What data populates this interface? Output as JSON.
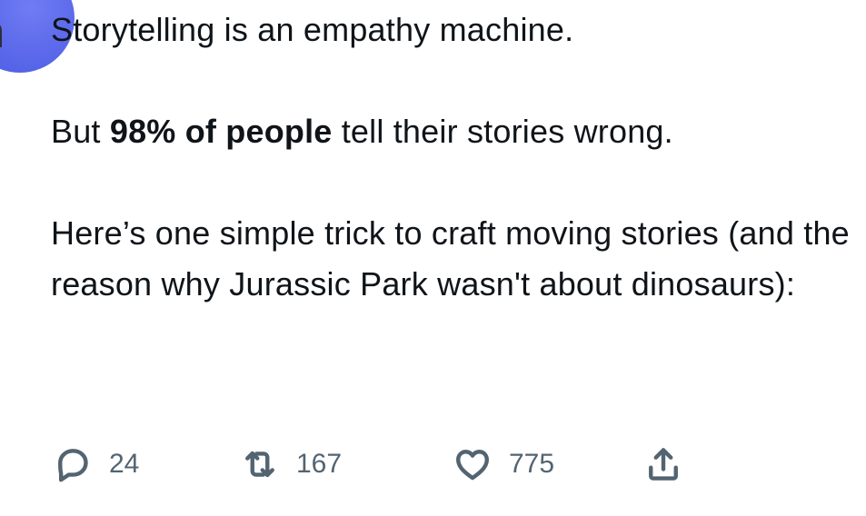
{
  "tweet": {
    "line1": "Storytelling is an empathy machine.",
    "para2": {
      "prefix": "But ",
      "bold": "98% of people",
      "suffix": " tell their stories wrong."
    },
    "para3": "Here’s one simple trick to craft moving stories (and the reason why Jurassic Park wasn't about dinosaurs):"
  },
  "actions": {
    "reply": {
      "icon": "reply-icon",
      "count": "24"
    },
    "retweet": {
      "icon": "retweet-icon",
      "count": "167"
    },
    "like": {
      "icon": "heart-icon",
      "count": "775"
    },
    "share": {
      "icon": "share-icon"
    }
  },
  "colors": {
    "text": "#0f1419",
    "secondary": "#536471",
    "avatar": "#5a68ea"
  }
}
